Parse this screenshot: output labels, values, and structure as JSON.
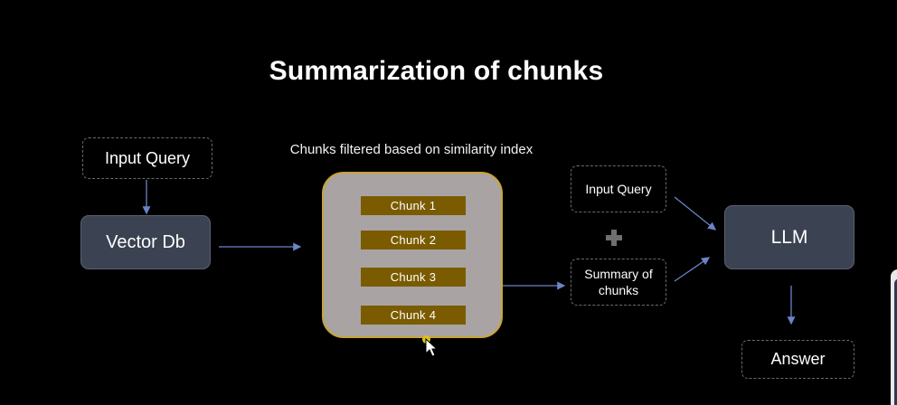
{
  "slide": {
    "title": "Summarization of chunks",
    "caption": "Chunks filtered based on similarity index",
    "nodes": {
      "input_query_left": "Input Query",
      "vector_db": "Vector Db",
      "input_query_right": "Input Query",
      "summary_of_chunks": "Summary of chunks",
      "llm": "LLM",
      "answer": "Answer"
    },
    "chunks": [
      "Chunk 1",
      "Chunk 2",
      "Chunk 3",
      "Chunk 4"
    ],
    "colors": {
      "background": "#000000",
      "node_fill": "#3b4252",
      "chunk_fill": "#7a5b00",
      "container_fill": "#a9a4a3",
      "container_border": "#c8a43a",
      "arrow": "#6d83c7"
    }
  }
}
